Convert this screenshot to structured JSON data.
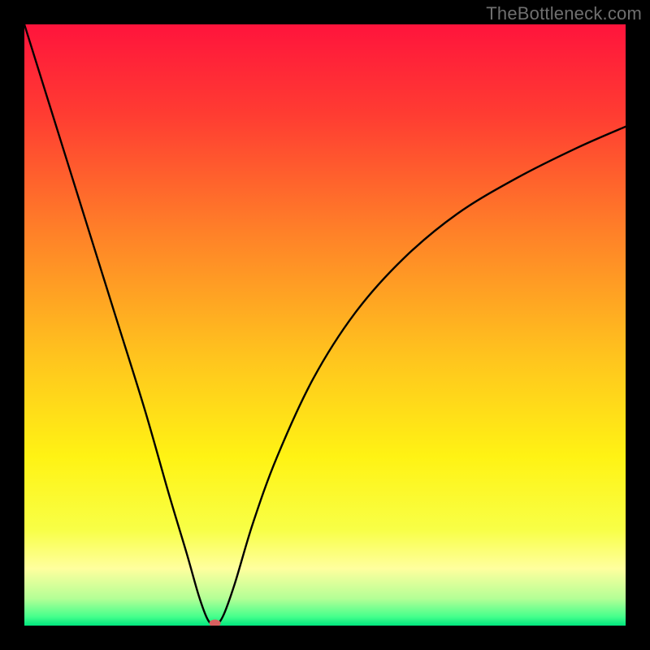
{
  "watermark": "TheBottleneck.com",
  "chart_data": {
    "type": "line",
    "title": "",
    "xlabel": "",
    "ylabel": "",
    "xlim": [
      0,
      100
    ],
    "ylim": [
      0,
      100
    ],
    "grid": false,
    "legend": false,
    "gradient_stops": [
      {
        "offset": 0.0,
        "color": "#ff143c"
      },
      {
        "offset": 0.15,
        "color": "#ff3c32"
      },
      {
        "offset": 0.35,
        "color": "#ff8228"
      },
      {
        "offset": 0.55,
        "color": "#ffc31e"
      },
      {
        "offset": 0.72,
        "color": "#fff314"
      },
      {
        "offset": 0.84,
        "color": "#f8ff46"
      },
      {
        "offset": 0.905,
        "color": "#ffff9e"
      },
      {
        "offset": 0.955,
        "color": "#b4ff96"
      },
      {
        "offset": 0.985,
        "color": "#46ff8c"
      },
      {
        "offset": 1.0,
        "color": "#00e67e"
      }
    ],
    "series": [
      {
        "name": "bottleneck-curve",
        "x": [
          0,
          5,
          10,
          15,
          20,
          24,
          27,
          29,
          30.5,
          31.7,
          33,
          35,
          38,
          42,
          48,
          55,
          63,
          72,
          82,
          92,
          100
        ],
        "values": [
          100,
          84,
          68,
          52,
          36,
          22,
          12,
          5,
          1,
          0.2,
          1.5,
          7,
          17,
          28,
          41,
          52,
          61,
          68.5,
          74.5,
          79.5,
          83
        ]
      }
    ],
    "marker": {
      "x": 31.7,
      "y": 0.4,
      "color": "#d86060"
    }
  }
}
